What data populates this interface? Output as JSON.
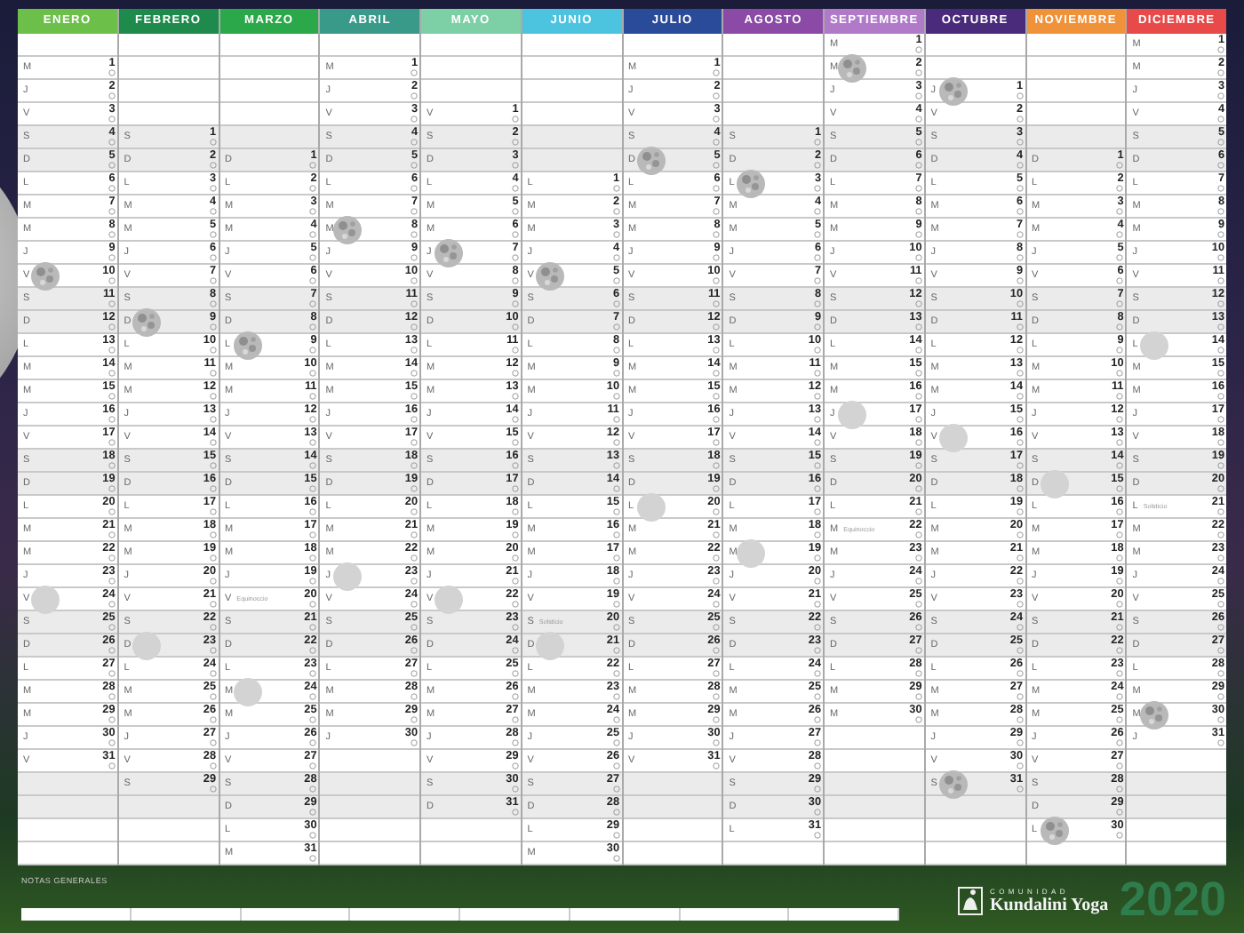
{
  "months": [
    {
      "name": "ENERO",
      "color": "#6cc04a",
      "cells": [
        null,
        [
          "M",
          "1"
        ],
        [
          "J",
          "2"
        ],
        [
          "V",
          "3"
        ],
        [
          "S",
          "4"
        ],
        [
          "D",
          "5"
        ],
        [
          "L",
          "6"
        ],
        [
          "M",
          "7"
        ],
        [
          "M",
          "8"
        ],
        [
          "J",
          "9"
        ],
        {
          "weekday": "V",
          "day": "10",
          "kind": "full_moon"
        },
        [
          "S",
          "11"
        ],
        [
          "D",
          "12"
        ],
        [
          "L",
          "13"
        ],
        [
          "M",
          "14"
        ],
        [
          "M",
          "15"
        ],
        [
          "J",
          "16"
        ],
        [
          "V",
          "17"
        ],
        [
          "S",
          "18"
        ],
        [
          "D",
          "19"
        ],
        [
          "L",
          "20"
        ],
        [
          "M",
          "21"
        ],
        [
          "M",
          "22"
        ],
        [
          "J",
          "23"
        ],
        {
          "weekday": "V",
          "day": "24",
          "kind": "new_moon"
        },
        [
          "S",
          "25"
        ],
        [
          "D",
          "26"
        ],
        [
          "L",
          "27"
        ],
        [
          "M",
          "28"
        ],
        [
          "M",
          "29"
        ],
        [
          "J",
          "30"
        ],
        [
          "V",
          "31"
        ]
      ]
    },
    {
      "name": "FEBRERO",
      "color": "#1e8a4c",
      "cells": [
        null,
        null,
        null,
        null,
        [
          "S",
          "1"
        ],
        [
          "D",
          "2"
        ],
        [
          "L",
          "3"
        ],
        [
          "M",
          "4"
        ],
        [
          "M",
          "5"
        ],
        [
          "J",
          "6"
        ],
        [
          "V",
          "7"
        ],
        [
          "S",
          "8"
        ],
        {
          "weekday": "D",
          "day": "9",
          "kind": "full_moon"
        },
        [
          "L",
          "10"
        ],
        [
          "M",
          "11"
        ],
        [
          "M",
          "12"
        ],
        [
          "J",
          "13"
        ],
        [
          "V",
          "14"
        ],
        [
          "S",
          "15"
        ],
        [
          "D",
          "16"
        ],
        [
          "L",
          "17"
        ],
        [
          "M",
          "18"
        ],
        [
          "M",
          "19"
        ],
        [
          "J",
          "20"
        ],
        [
          "V",
          "21"
        ],
        [
          "S",
          "22"
        ],
        {
          "weekday": "D",
          "day": "23",
          "kind": "new_moon"
        },
        [
          "L",
          "24"
        ],
        [
          "M",
          "25"
        ],
        [
          "M",
          "26"
        ],
        [
          "J",
          "27"
        ],
        [
          "V",
          "28"
        ],
        [
          "S",
          "29"
        ]
      ]
    },
    {
      "name": "MARZO",
      "color": "#2aa84a",
      "cells": [
        null,
        null,
        null,
        null,
        null,
        [
          "D",
          "1"
        ],
        [
          "L",
          "2"
        ],
        [
          "M",
          "3"
        ],
        [
          "M",
          "4"
        ],
        [
          "J",
          "5"
        ],
        [
          "V",
          "6"
        ],
        [
          "S",
          "7"
        ],
        [
          "D",
          "8"
        ],
        {
          "weekday": "L",
          "day": "9",
          "kind": "full_moon"
        },
        [
          "M",
          "10"
        ],
        [
          "M",
          "11"
        ],
        [
          "J",
          "12"
        ],
        [
          "V",
          "13"
        ],
        [
          "S",
          "14"
        ],
        [
          "D",
          "15"
        ],
        [
          "L",
          "16"
        ],
        [
          "M",
          "17"
        ],
        [
          "M",
          "18"
        ],
        [
          "J",
          "19"
        ],
        {
          "weekday": "V",
          "day": "20",
          "note": "Equinoccio"
        },
        [
          "S",
          "21"
        ],
        [
          "D",
          "22"
        ],
        [
          "L",
          "23"
        ],
        {
          "weekday": "M",
          "day": "24",
          "kind": "new_moon"
        },
        [
          "M",
          "25"
        ],
        [
          "J",
          "26"
        ],
        [
          "V",
          "27"
        ],
        [
          "S",
          "28"
        ],
        [
          "D",
          "29"
        ],
        [
          "L",
          "30"
        ],
        [
          "M",
          "31"
        ]
      ]
    },
    {
      "name": "ABRIL",
      "color": "#3a9a8a",
      "cells": [
        null,
        [
          "M",
          "1"
        ],
        [
          "J",
          "2"
        ],
        [
          "V",
          "3"
        ],
        [
          "S",
          "4"
        ],
        [
          "D",
          "5"
        ],
        [
          "L",
          "6"
        ],
        [
          "M",
          "7"
        ],
        {
          "weekday": "M",
          "day": "8",
          "kind": "full_moon"
        },
        [
          "J",
          "9"
        ],
        [
          "V",
          "10"
        ],
        [
          "S",
          "11"
        ],
        [
          "D",
          "12"
        ],
        [
          "L",
          "13"
        ],
        [
          "M",
          "14"
        ],
        [
          "M",
          "15"
        ],
        [
          "J",
          "16"
        ],
        [
          "V",
          "17"
        ],
        [
          "S",
          "18"
        ],
        [
          "D",
          "19"
        ],
        [
          "L",
          "20"
        ],
        [
          "M",
          "21"
        ],
        [
          "M",
          "22"
        ],
        {
          "weekday": "J",
          "day": "23",
          "kind": "new_moon"
        },
        [
          "V",
          "24"
        ],
        [
          "S",
          "25"
        ],
        [
          "D",
          "26"
        ],
        [
          "L",
          "27"
        ],
        [
          "M",
          "28"
        ],
        [
          "M",
          "29"
        ],
        [
          "J",
          "30"
        ]
      ]
    },
    {
      "name": "MAYO",
      "color": "#7dcfa6",
      "cells": [
        null,
        null,
        null,
        [
          "V",
          "1"
        ],
        [
          "S",
          "2"
        ],
        [
          "D",
          "3"
        ],
        [
          "L",
          "4"
        ],
        [
          "M",
          "5"
        ],
        [
          "M",
          "6"
        ],
        {
          "weekday": "J",
          "day": "7",
          "kind": "full_moon"
        },
        [
          "V",
          "8"
        ],
        [
          "S",
          "9"
        ],
        [
          "D",
          "10"
        ],
        [
          "L",
          "11"
        ],
        [
          "M",
          "12"
        ],
        [
          "M",
          "13"
        ],
        [
          "J",
          "14"
        ],
        [
          "V",
          "15"
        ],
        [
          "S",
          "16"
        ],
        [
          "D",
          "17"
        ],
        [
          "L",
          "18"
        ],
        [
          "M",
          "19"
        ],
        [
          "M",
          "20"
        ],
        [
          "J",
          "21"
        ],
        {
          "weekday": "V",
          "day": "22",
          "kind": "new_moon"
        },
        [
          "S",
          "23"
        ],
        [
          "D",
          "24"
        ],
        [
          "L",
          "25"
        ],
        [
          "M",
          "26"
        ],
        [
          "M",
          "27"
        ],
        [
          "J",
          "28"
        ],
        [
          "V",
          "29"
        ],
        [
          "S",
          "30"
        ],
        [
          "D",
          "31"
        ]
      ]
    },
    {
      "name": "JUNIO",
      "color": "#4cc4e0",
      "cells": [
        null,
        null,
        null,
        null,
        null,
        null,
        [
          "L",
          "1"
        ],
        [
          "M",
          "2"
        ],
        [
          "M",
          "3"
        ],
        [
          "J",
          "4"
        ],
        {
          "weekday": "V",
          "day": "5",
          "kind": "full_moon"
        },
        [
          "S",
          "6"
        ],
        [
          "D",
          "7"
        ],
        [
          "L",
          "8"
        ],
        [
          "M",
          "9"
        ],
        [
          "M",
          "10"
        ],
        [
          "J",
          "11"
        ],
        [
          "V",
          "12"
        ],
        [
          "S",
          "13"
        ],
        [
          "D",
          "14"
        ],
        [
          "L",
          "15"
        ],
        [
          "M",
          "16"
        ],
        [
          "M",
          "17"
        ],
        [
          "J",
          "18"
        ],
        [
          "V",
          "19"
        ],
        {
          "weekday": "S",
          "day": "20",
          "note": "Solsticio"
        },
        {
          "weekday": "D",
          "day": "21",
          "kind": "new_moon"
        },
        [
          "L",
          "22"
        ],
        [
          "M",
          "23"
        ],
        [
          "M",
          "24"
        ],
        [
          "J",
          "25"
        ],
        [
          "V",
          "26"
        ],
        [
          "S",
          "27"
        ],
        [
          "D",
          "28"
        ],
        [
          "L",
          "29"
        ],
        [
          "M",
          "30"
        ]
      ]
    },
    {
      "name": "JULIO",
      "color": "#2a4a9a",
      "cells": [
        null,
        [
          "M",
          "1"
        ],
        [
          "J",
          "2"
        ],
        [
          "V",
          "3"
        ],
        [
          "S",
          "4"
        ],
        {
          "weekday": "D",
          "day": "5",
          "kind": "full_moon"
        },
        [
          "L",
          "6"
        ],
        [
          "M",
          "7"
        ],
        [
          "M",
          "8"
        ],
        [
          "J",
          "9"
        ],
        [
          "V",
          "10"
        ],
        [
          "S",
          "11"
        ],
        [
          "D",
          "12"
        ],
        [
          "L",
          "13"
        ],
        [
          "M",
          "14"
        ],
        [
          "M",
          "15"
        ],
        [
          "J",
          "16"
        ],
        [
          "V",
          "17"
        ],
        [
          "S",
          "18"
        ],
        [
          "D",
          "19"
        ],
        {
          "weekday": "L",
          "day": "20",
          "kind": "new_moon"
        },
        [
          "M",
          "21"
        ],
        [
          "M",
          "22"
        ],
        [
          "J",
          "23"
        ],
        [
          "V",
          "24"
        ],
        [
          "S",
          "25"
        ],
        [
          "D",
          "26"
        ],
        [
          "L",
          "27"
        ],
        [
          "M",
          "28"
        ],
        [
          "M",
          "29"
        ],
        [
          "J",
          "30"
        ],
        [
          "V",
          "31"
        ]
      ]
    },
    {
      "name": "AGOSTO",
      "color": "#8a4aa6",
      "cells": [
        null,
        null,
        null,
        null,
        [
          "S",
          "1"
        ],
        [
          "D",
          "2"
        ],
        {
          "weekday": "L",
          "day": "3",
          "kind": "full_moon"
        },
        [
          "M",
          "4"
        ],
        [
          "M",
          "5"
        ],
        [
          "J",
          "6"
        ],
        [
          "V",
          "7"
        ],
        [
          "S",
          "8"
        ],
        [
          "D",
          "9"
        ],
        [
          "L",
          "10"
        ],
        [
          "M",
          "11"
        ],
        [
          "M",
          "12"
        ],
        [
          "J",
          "13"
        ],
        [
          "V",
          "14"
        ],
        [
          "S",
          "15"
        ],
        [
          "D",
          "16"
        ],
        [
          "L",
          "17"
        ],
        [
          "M",
          "18"
        ],
        {
          "weekday": "M",
          "day": "19",
          "kind": "new_moon"
        },
        [
          "J",
          "20"
        ],
        [
          "V",
          "21"
        ],
        [
          "S",
          "22"
        ],
        [
          "D",
          "23"
        ],
        [
          "L",
          "24"
        ],
        [
          "M",
          "25"
        ],
        [
          "M",
          "26"
        ],
        [
          "J",
          "27"
        ],
        [
          "V",
          "28"
        ],
        [
          "S",
          "29"
        ],
        [
          "D",
          "30"
        ],
        [
          "L",
          "31"
        ]
      ]
    },
    {
      "name": "SEPTIEMBRE",
      "color": "#b07ac8",
      "cells": [
        [
          "M",
          "1"
        ],
        {
          "weekday": "M",
          "day": "2",
          "kind": "full_moon"
        },
        [
          "J",
          "3"
        ],
        [
          "V",
          "4"
        ],
        [
          "S",
          "5"
        ],
        [
          "D",
          "6"
        ],
        [
          "L",
          "7"
        ],
        [
          "M",
          "8"
        ],
        [
          "M",
          "9"
        ],
        [
          "J",
          "10"
        ],
        [
          "V",
          "11"
        ],
        [
          "S",
          "12"
        ],
        [
          "D",
          "13"
        ],
        [
          "L",
          "14"
        ],
        [
          "M",
          "15"
        ],
        [
          "M",
          "16"
        ],
        {
          "weekday": "J",
          "day": "17",
          "kind": "new_moon"
        },
        [
          "V",
          "18"
        ],
        [
          "S",
          "19"
        ],
        [
          "D",
          "20"
        ],
        [
          "L",
          "21"
        ],
        {
          "weekday": "M",
          "day": "22",
          "note": "Equinoccio"
        },
        [
          "M",
          "23"
        ],
        [
          "J",
          "24"
        ],
        [
          "V",
          "25"
        ],
        [
          "S",
          "26"
        ],
        [
          "D",
          "27"
        ],
        [
          "L",
          "28"
        ],
        [
          "M",
          "29"
        ],
        [
          "M",
          "30"
        ]
      ]
    },
    {
      "name": "OCTUBRE",
      "color": "#4a2a7a",
      "cells": [
        null,
        null,
        {
          "weekday": "J",
          "day": "1",
          "kind": "full_moon"
        },
        [
          "V",
          "2"
        ],
        [
          "S",
          "3"
        ],
        [
          "D",
          "4"
        ],
        [
          "L",
          "5"
        ],
        [
          "M",
          "6"
        ],
        [
          "M",
          "7"
        ],
        [
          "J",
          "8"
        ],
        [
          "V",
          "9"
        ],
        [
          "S",
          "10"
        ],
        [
          "D",
          "11"
        ],
        [
          "L",
          "12"
        ],
        [
          "M",
          "13"
        ],
        [
          "M",
          "14"
        ],
        [
          "J",
          "15"
        ],
        {
          "weekday": "V",
          "day": "16",
          "kind": "new_moon"
        },
        [
          "S",
          "17"
        ],
        [
          "D",
          "18"
        ],
        [
          "L",
          "19"
        ],
        [
          "M",
          "20"
        ],
        [
          "M",
          "21"
        ],
        [
          "J",
          "22"
        ],
        [
          "V",
          "23"
        ],
        [
          "S",
          "24"
        ],
        [
          "D",
          "25"
        ],
        [
          "L",
          "26"
        ],
        [
          "M",
          "27"
        ],
        [
          "M",
          "28"
        ],
        [
          "J",
          "29"
        ],
        [
          "V",
          "30"
        ],
        {
          "weekday": "S",
          "day": "31",
          "kind": "full_moon"
        }
      ]
    },
    {
      "name": "NOVIEMBRE",
      "color": "#f0923a",
      "cells": [
        null,
        null,
        null,
        null,
        null,
        [
          "D",
          "1"
        ],
        [
          "L",
          "2"
        ],
        [
          "M",
          "3"
        ],
        [
          "M",
          "4"
        ],
        [
          "J",
          "5"
        ],
        [
          "V",
          "6"
        ],
        [
          "S",
          "7"
        ],
        [
          "D",
          "8"
        ],
        [
          "L",
          "9"
        ],
        [
          "M",
          "10"
        ],
        [
          "M",
          "11"
        ],
        [
          "J",
          "12"
        ],
        [
          "V",
          "13"
        ],
        [
          "S",
          "14"
        ],
        {
          "weekday": "D",
          "day": "15",
          "kind": "new_moon"
        },
        [
          "L",
          "16"
        ],
        [
          "M",
          "17"
        ],
        [
          "M",
          "18"
        ],
        [
          "J",
          "19"
        ],
        [
          "V",
          "20"
        ],
        [
          "S",
          "21"
        ],
        [
          "D",
          "22"
        ],
        [
          "L",
          "23"
        ],
        [
          "M",
          "24"
        ],
        [
          "M",
          "25"
        ],
        [
          "J",
          "26"
        ],
        [
          "V",
          "27"
        ],
        [
          "S",
          "28"
        ],
        [
          "D",
          "29"
        ],
        {
          "weekday": "L",
          "day": "30",
          "kind": "full_moon"
        }
      ]
    },
    {
      "name": "DICIEMBRE",
      "color": "#e84a4a",
      "cells": [
        [
          "M",
          "1"
        ],
        [
          "M",
          "2"
        ],
        [
          "J",
          "3"
        ],
        [
          "V",
          "4"
        ],
        [
          "S",
          "5"
        ],
        [
          "D",
          "6"
        ],
        [
          "L",
          "7"
        ],
        [
          "M",
          "8"
        ],
        [
          "M",
          "9"
        ],
        [
          "J",
          "10"
        ],
        [
          "V",
          "11"
        ],
        [
          "S",
          "12"
        ],
        [
          "D",
          "13"
        ],
        {
          "weekday": "L",
          "day": "14",
          "kind": "new_moon"
        },
        [
          "M",
          "15"
        ],
        [
          "M",
          "16"
        ],
        [
          "J",
          "17"
        ],
        [
          "V",
          "18"
        ],
        [
          "S",
          "19"
        ],
        [
          "D",
          "20"
        ],
        {
          "weekday": "L",
          "day": "21",
          "note": "Solsticio"
        },
        [
          "M",
          "22"
        ],
        [
          "M",
          "23"
        ],
        [
          "J",
          "24"
        ],
        [
          "V",
          "25"
        ],
        [
          "S",
          "26"
        ],
        [
          "D",
          "27"
        ],
        [
          "L",
          "28"
        ],
        [
          "M",
          "29"
        ],
        {
          "weekday": "M",
          "day": "30",
          "kind": "full_moon"
        },
        [
          "J",
          "31"
        ]
      ]
    }
  ],
  "footer": {
    "notes_label": "NOTAS GENERALES",
    "logo": {
      "top": "COMUNIDAD",
      "name": "Kundalini Yoga"
    },
    "year": "2020"
  }
}
